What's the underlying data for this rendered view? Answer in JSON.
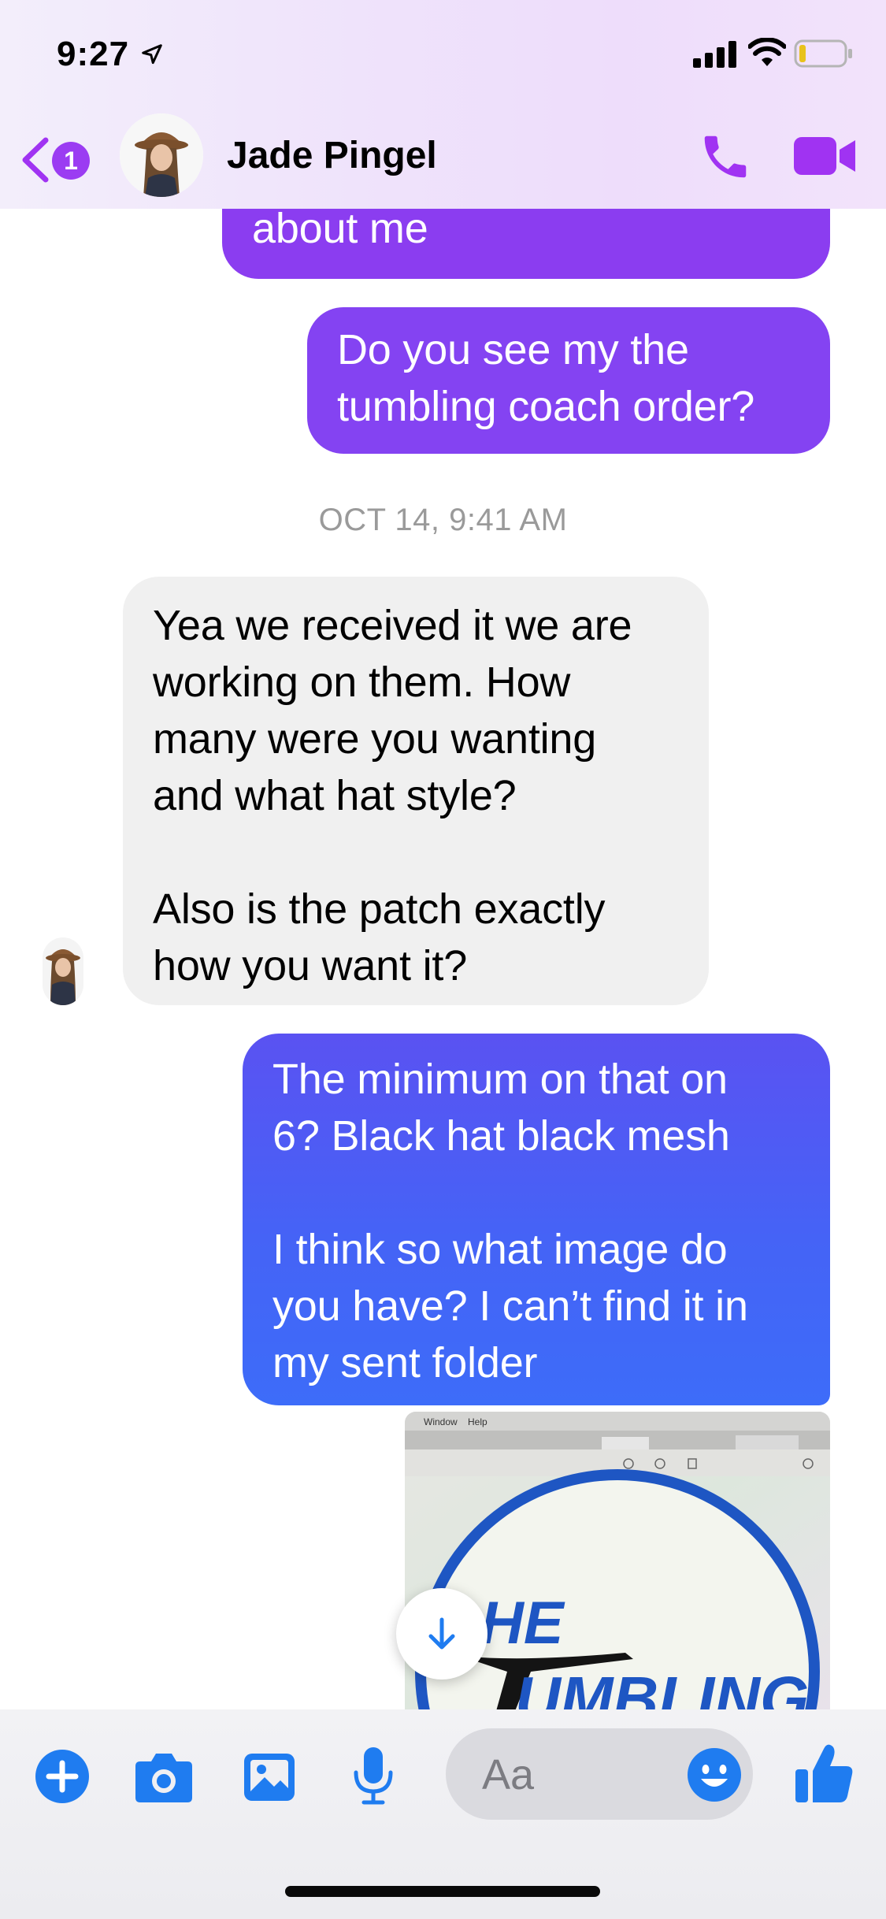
{
  "status_bar": {
    "time": "9:27",
    "icons": [
      "location-arrow-icon",
      "cellular-signal-icon",
      "wifi-icon",
      "battery-icon"
    ]
  },
  "header": {
    "back_badge": "1",
    "contact_name": "Jade Pingel",
    "icons": [
      "chevron-left-icon",
      "phone-icon",
      "video-camera-icon"
    ]
  },
  "conversation": {
    "messages": [
      {
        "direction": "outgoing",
        "text": "about me"
      },
      {
        "direction": "outgoing",
        "text": "Do you see my the\ntumbling coach order?"
      },
      {
        "direction": "timestamp",
        "text": "OCT 14, 9:41 AM"
      },
      {
        "direction": "incoming",
        "text": "Yea we received it we are\nworking on them. How\nmany were you wanting\nand what hat style?\n\nAlso is the patch exactly\nhow you want it?"
      },
      {
        "direction": "outgoing",
        "text": "The minimum on that on\n6? Black hat black mesh\n\nI think so what image do\nyou have? I can’t find it in\nmy sent folder"
      }
    ],
    "photo": {
      "menu_items": [
        "Window",
        "Help"
      ],
      "logo_text": "HE",
      "logo_text_lower": "UMBLING"
    }
  },
  "composer": {
    "placeholder": "Aa",
    "icons": [
      "plus-icon",
      "camera-icon",
      "photo-gallery-icon",
      "microphone-icon",
      "emoji-icon",
      "thumbs-up-icon"
    ]
  },
  "colors": {
    "accent": "#a033f2",
    "outgoing_purple": "#8a3ff1",
    "outgoing_blue": "#4563f6",
    "incoming_gray": "#f0f0f0",
    "composer_blue": "#1f7cf0"
  }
}
